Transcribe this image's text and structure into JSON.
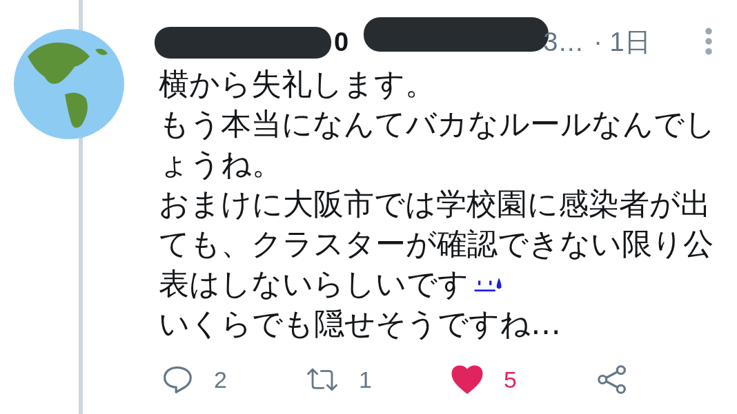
{
  "tweet": {
    "name_visible": "0",
    "handle_visible": "3…",
    "time": "· 1日",
    "lines": [
      {
        "text": "横から失礼します。",
        "emoji": false
      },
      {
        "text": "もう本当になんてバカなルールなんでし",
        "emoji": false
      },
      {
        "text": "ょうね。",
        "emoji": false
      },
      {
        "text": "おまけに大阪市では学校園に感染者が出",
        "emoji": false
      },
      {
        "text": "ても、クラスターが確認できない限り公",
        "emoji": false
      },
      {
        "text": "表はしないらしいです",
        "emoji": true
      },
      {
        "text": "いくらでも隠せそうですね…",
        "emoji": false
      }
    ],
    "actions": [
      {
        "kind": "reply",
        "count": "2"
      },
      {
        "kind": "retweet",
        "count": "1"
      },
      {
        "kind": "like",
        "count": "5",
        "liked": true
      },
      {
        "kind": "share"
      }
    ]
  }
}
